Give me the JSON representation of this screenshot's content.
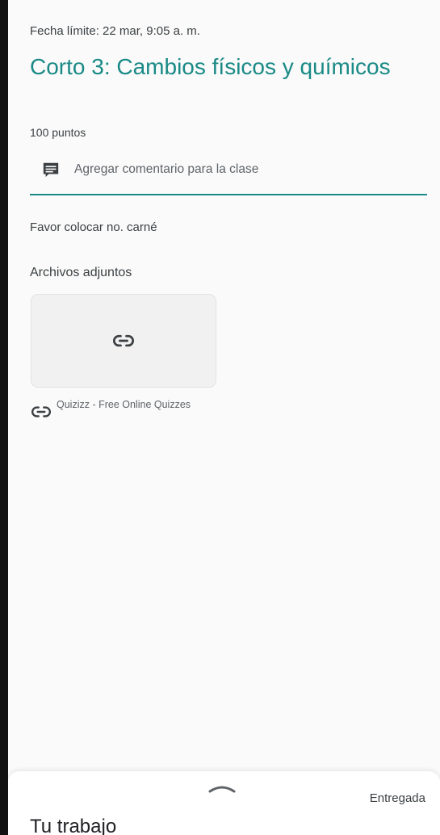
{
  "assignment": {
    "due_date": "Fecha límite: 22 mar, 9:05 a. m.",
    "title": "Corto 3: Cambios físicos y químicos",
    "points": "100 puntos",
    "class_comment_label": "Agregar comentario para la clase",
    "instructions": "Favor colocar no. carné"
  },
  "attachments": {
    "heading": "Archivos adjuntos",
    "items": [
      {
        "title": "Quizizz - Free Online Quizzes",
        "icon": "link-icon"
      }
    ]
  },
  "bottom_sheet": {
    "label": "Tu trabajo",
    "status": "Entregada",
    "handle_icon": "chevron-up-icon"
  },
  "colors": {
    "accent": "#1a8a86",
    "text_secondary": "#5f6368"
  }
}
